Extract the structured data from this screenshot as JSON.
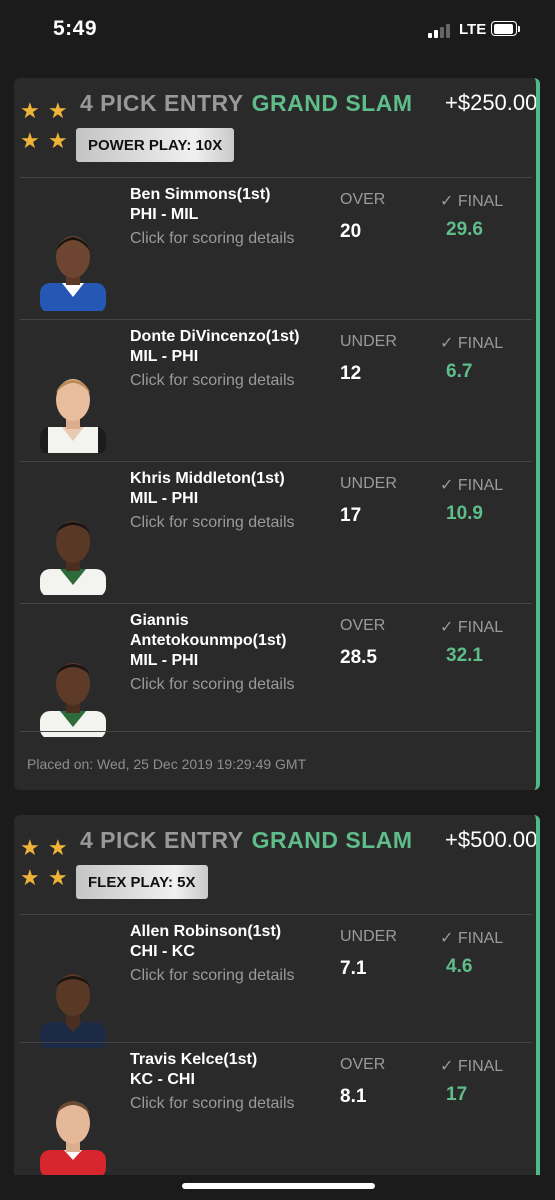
{
  "status_bar": {
    "time": "5:49",
    "network": "LTE"
  },
  "entries": [
    {
      "title": "4 PICK ENTRY",
      "type": "GRAND SLAM",
      "payout": "+$250.00",
      "play": "POWER PLAY: 10X",
      "picks": [
        {
          "name": "Ben Simmons(1st)",
          "matchup": "PHI - MIL",
          "link": "Click for scoring details",
          "direction": "OVER",
          "line": "20",
          "final_label": "✓ FINAL",
          "final": "29.6",
          "jersey_color": "#2557b4"
        },
        {
          "name": "Donte DiVincenzo(1st)",
          "matchup": "MIL - PHI",
          "link": "Click for scoring details",
          "direction": "UNDER",
          "line": "12",
          "final_label": "✓ FINAL",
          "final": "6.7",
          "jersey_color": "#f3f3ef"
        },
        {
          "name": "Khris Middleton(1st)",
          "matchup": "MIL - PHI",
          "link": "Click for scoring details",
          "direction": "UNDER",
          "line": "17",
          "final_label": "✓ FINAL",
          "final": "10.9",
          "jersey_color": "#f3f3ef"
        },
        {
          "name": "Giannis Antetokounmpo(1st)",
          "matchup": "MIL - PHI",
          "link": "Click for scoring details",
          "direction": "OVER",
          "line": "28.5",
          "final_label": "✓ FINAL",
          "final": "32.1",
          "jersey_color": "#f3f3ef"
        }
      ],
      "placed_on": "Placed on: Wed, 25 Dec 2019 19:29:49 GMT"
    },
    {
      "title": "4 PICK ENTRY",
      "type": "GRAND SLAM",
      "payout": "+$500.00",
      "play": "FLEX PLAY: 5X",
      "picks": [
        {
          "name": "Allen Robinson(1st)",
          "matchup": "CHI - KC",
          "link": "Click for scoring details",
          "direction": "UNDER",
          "line": "7.1",
          "final_label": "✓ FINAL",
          "final": "4.6",
          "jersey_color": "#1c2a45"
        },
        {
          "name": "Travis Kelce(1st)",
          "matchup": "KC - CHI",
          "link": "Click for scoring details",
          "direction": "OVER",
          "line": "8.1",
          "final_label": "✓ FINAL",
          "final": "17",
          "jersey_color": "#d7262e"
        }
      ]
    }
  ],
  "colors": {
    "accent_green": "#5fbd8a",
    "star_gold": "#f0b33a",
    "card_bg": "#2a2a2a"
  }
}
